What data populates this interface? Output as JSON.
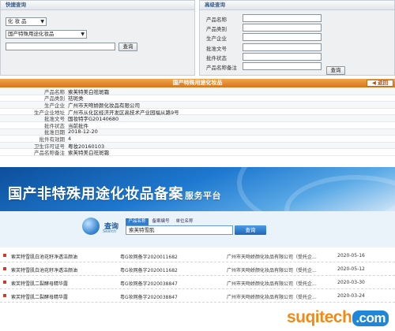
{
  "quick_search": {
    "title": "快捷查询",
    "category_select": "化 妆 品",
    "subtype_select": "国产特殊用途化妆品",
    "input_value": "",
    "search_button": "查询"
  },
  "advanced_search": {
    "title": "高级查询",
    "fields": [
      {
        "label": "产品名称",
        "value": ""
      },
      {
        "label": "产品类别",
        "value": ""
      },
      {
        "label": "生产企业",
        "value": ""
      },
      {
        "label": "批准文号",
        "value": ""
      },
      {
        "label": "批件状态",
        "value": ""
      },
      {
        "label": "产品名称备注",
        "value": ""
      }
    ],
    "search_button": "查询"
  },
  "detail": {
    "header": "国产特殊用途化妆品",
    "back_button": "返回",
    "rows": [
      {
        "label": "产品名称",
        "value": "索芙特美白祛斑霜"
      },
      {
        "label": "产品类别",
        "value": "祛斑类"
      },
      {
        "label": "生产企业",
        "value": "广州市天吻娇颜化妆品有限公司"
      },
      {
        "label": "生产企业地址",
        "value": "广州市从化区经济开发区高技术产业园福从路9号"
      },
      {
        "label": "批准文号",
        "value": "国妆特字G20140680"
      },
      {
        "label": "批件状态",
        "value": "当前批件"
      },
      {
        "label": "批准日期",
        "value": "2018-12-20"
      },
      {
        "label": "批件有效期",
        "value": "4"
      },
      {
        "label": "卫生许可证号",
        "value": "粤妆20160103"
      },
      {
        "label": "产品名称备注",
        "value": "索芙特美白祛斑霜"
      }
    ]
  },
  "banner": {
    "title": "国产非特殊用途化妆品备案",
    "subtitle": "服务平台"
  },
  "search_section": {
    "label_cn": "查询",
    "label_en": "Search",
    "tabs": [
      "产品名称",
      "备案编号",
      "单位名称"
    ],
    "active_tab": 0,
    "input_value": "索芙特雪肌",
    "button": "查询"
  },
  "results": [
    {
      "name": "索芙特雪肌白池花籽净透洁颜油",
      "reg": "粤G妆网备字2020011682",
      "company": "广州市天吻娇颜化妆品有限公司（受托企...",
      "date": "2020-05-16"
    },
    {
      "name": "索芙特雪肌白池花籽净透洁颜油",
      "reg": "粤G妆网备字2020011682",
      "company": "广州市天吻娇颜化妆品有限公司（受托企...",
      "date": "2020-05-12"
    },
    {
      "name": "索芙特雪肌二裂酵母精华露",
      "reg": "粤G妆网备字2020038847",
      "company": "广州市天吻娇颜化妆品有限公司（受托企...",
      "date": "2020-03-30"
    },
    {
      "name": "索芙特雪肌二裂酵母精华露",
      "reg": "粤G妆网备字2020038847",
      "company": "广州市天吻娇颜化妆品有限公司（受托企...",
      "date": "2020-03-24"
    }
  ],
  "watermark": {
    "text": "suqitech",
    "suffix": ".com"
  },
  "colors": {
    "header_orange": "#e08425",
    "banner_blue": "#1e78cf",
    "watermark_orange": "#f08a17",
    "bullet_red": "#d23a2b"
  }
}
